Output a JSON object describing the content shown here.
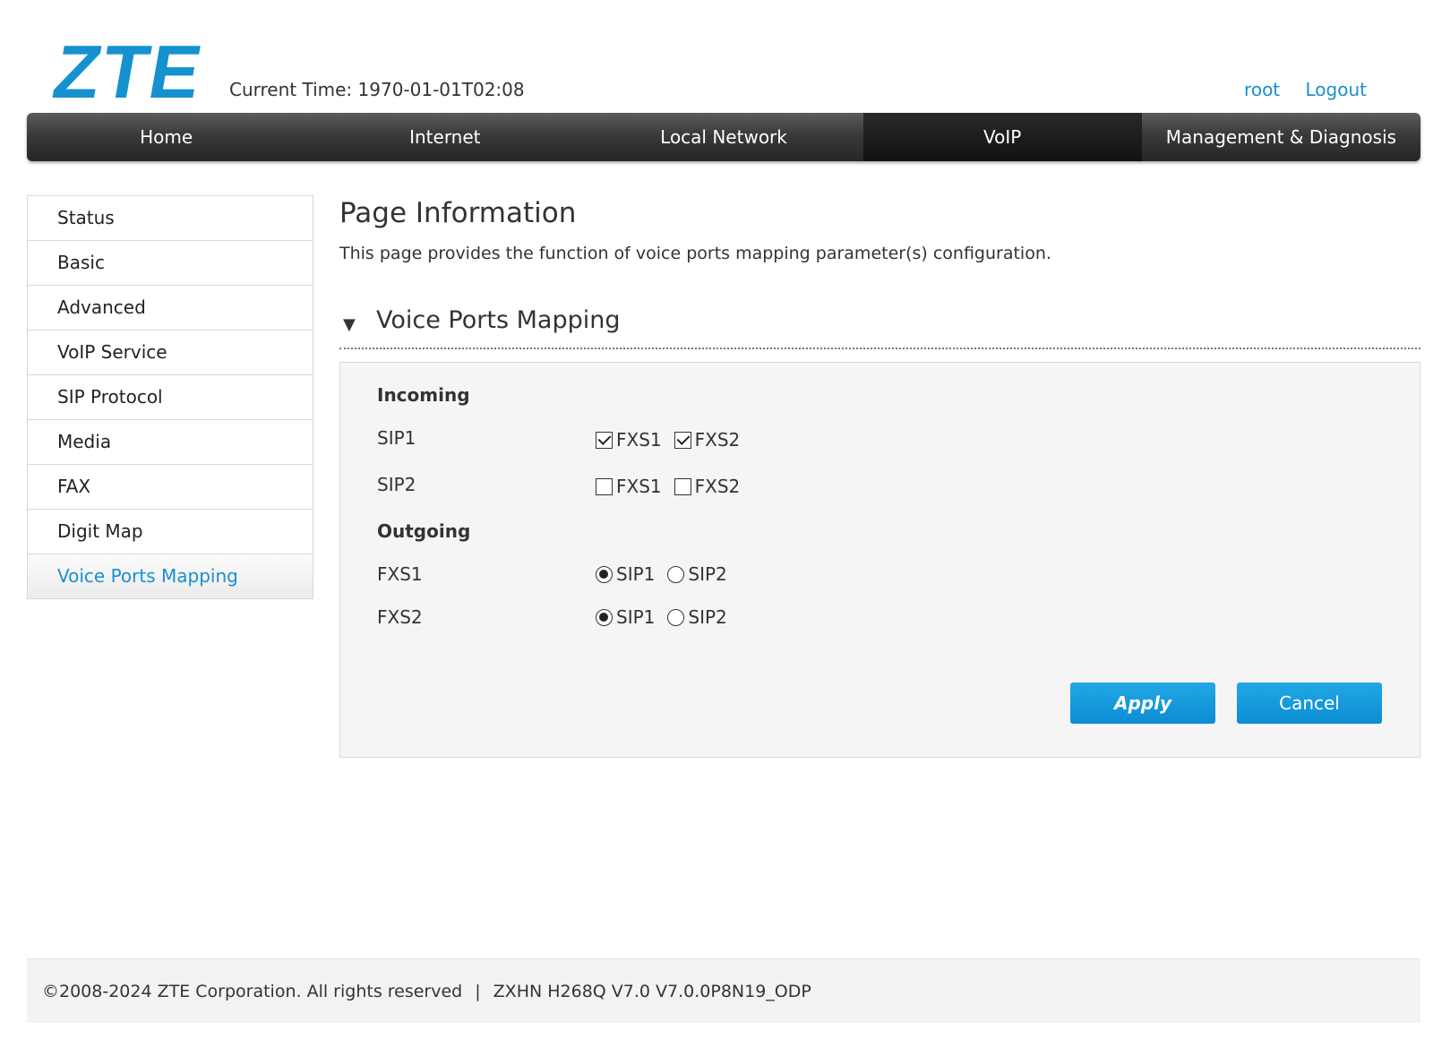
{
  "header": {
    "logo_text": "ZTE",
    "current_time": "Current Time: 1970-01-01T02:08",
    "user": "root",
    "logout": "Logout"
  },
  "nav": {
    "tabs": [
      {
        "label": "Home"
      },
      {
        "label": "Internet"
      },
      {
        "label": "Local Network"
      },
      {
        "label": "VoIP"
      },
      {
        "label": "Management & Diagnosis"
      }
    ],
    "active": "VoIP"
  },
  "sidebar": {
    "items": [
      {
        "label": "Status"
      },
      {
        "label": "Basic"
      },
      {
        "label": "Advanced"
      },
      {
        "label": "VoIP Service"
      },
      {
        "label": "SIP Protocol"
      },
      {
        "label": "Media"
      },
      {
        "label": "FAX"
      },
      {
        "label": "Digit Map"
      },
      {
        "label": "Voice Ports Mapping"
      }
    ],
    "active": "Voice Ports Mapping"
  },
  "page": {
    "title": "Page Information",
    "description": "This page provides the function of voice ports mapping parameter(s) configuration."
  },
  "section": {
    "title": "Voice Ports Mapping",
    "incoming": {
      "label": "Incoming",
      "rows": [
        {
          "label": "SIP1",
          "options": [
            {
              "label": "FXS1",
              "checked": true
            },
            {
              "label": "FXS2",
              "checked": true
            }
          ]
        },
        {
          "label": "SIP2",
          "options": [
            {
              "label": "FXS1",
              "checked": false
            },
            {
              "label": "FXS2",
              "checked": false
            }
          ]
        }
      ]
    },
    "outgoing": {
      "label": "Outgoing",
      "rows": [
        {
          "label": "FXS1",
          "options": [
            {
              "label": "SIP1",
              "selected": true
            },
            {
              "label": "SIP2",
              "selected": false
            }
          ]
        },
        {
          "label": "FXS2",
          "options": [
            {
              "label": "SIP1",
              "selected": true
            },
            {
              "label": "SIP2",
              "selected": false
            }
          ]
        }
      ]
    },
    "apply_label": "Apply",
    "cancel_label": "Cancel"
  },
  "footer": {
    "copyright": "©2008-2024 ZTE Corporation. All rights reserved",
    "separator": "|",
    "version": "ZXHN H268Q V7.0 V7.0.0P8N19_ODP"
  },
  "colors": {
    "accent": "#1a8fcf",
    "button": "#129bdc",
    "nav_dark": "#2b2b2b"
  }
}
